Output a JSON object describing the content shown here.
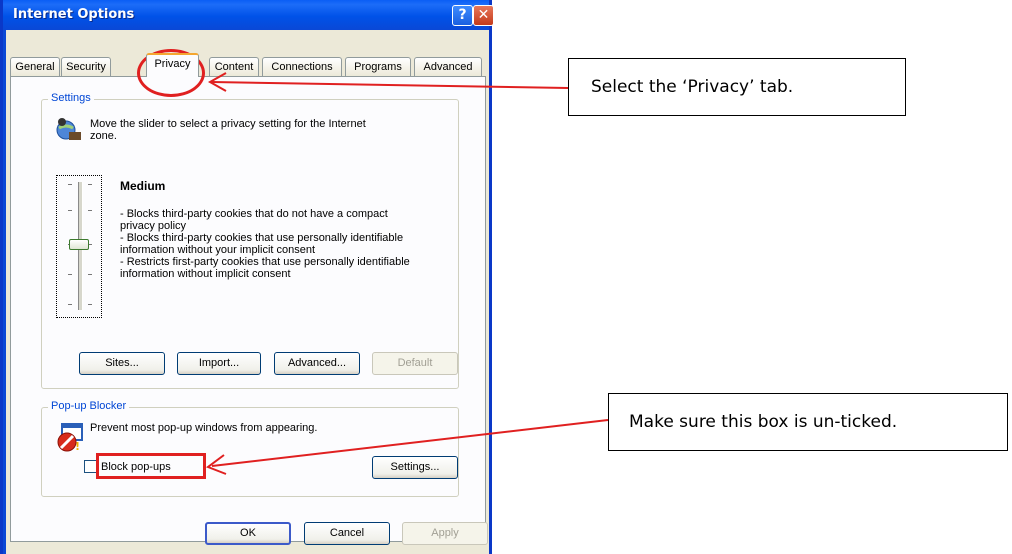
{
  "window": {
    "title": "Internet Options",
    "help_glyph": "?",
    "close_glyph": "✕"
  },
  "tabs": [
    {
      "label": "General"
    },
    {
      "label": "Security"
    },
    {
      "label": "Privacy",
      "active": true
    },
    {
      "label": "Content"
    },
    {
      "label": "Connections"
    },
    {
      "label": "Programs"
    },
    {
      "label": "Advanced"
    }
  ],
  "settings": {
    "group_title": "Settings",
    "intro_line1": "Move the slider to select a privacy setting for the Internet",
    "intro_line2": "zone.",
    "level_title": "Medium",
    "desc_lines": [
      "- Blocks third-party cookies that do not have a compact",
      "privacy policy",
      "- Blocks third-party cookies that use personally identifiable",
      "information without your implicit consent",
      "- Restricts first-party cookies that use personally identifiable",
      "information without implicit consent"
    ],
    "buttons": {
      "sites": "Sites...",
      "import": "Import...",
      "advanced": "Advanced...",
      "default": "Default"
    }
  },
  "popup": {
    "group_title": "Pop-up Blocker",
    "prevent_text": "Prevent most pop-up windows from appearing.",
    "checkbox_label": "Block pop-ups",
    "checkbox_checked": false,
    "settings_button": "Settings..."
  },
  "footer": {
    "ok": "OK",
    "cancel": "Cancel",
    "apply": "Apply"
  },
  "annotations": {
    "callout_privacy": "Select the ‘Privacy’ tab.",
    "callout_checkbox": "Make sure this box is un-ticked.",
    "highlight_color": "#e02020"
  }
}
